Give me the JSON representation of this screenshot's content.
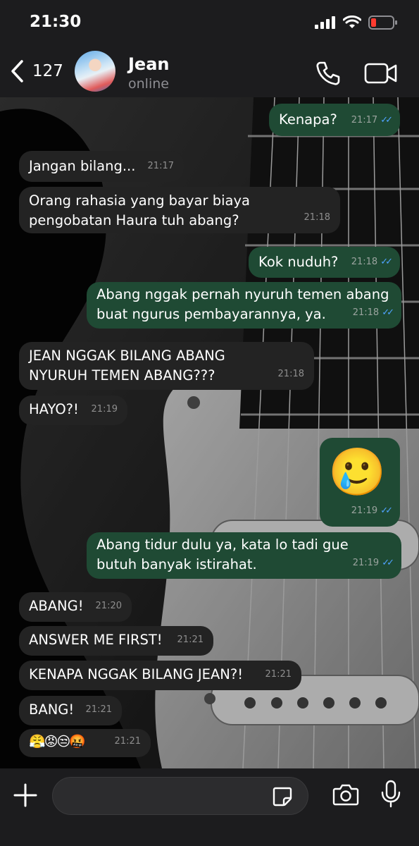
{
  "status_bar": {
    "time": "21:30"
  },
  "header": {
    "back_count": "127",
    "contact_name": "Jean",
    "contact_status": "online"
  },
  "messages": [
    {
      "direction": "out",
      "text": "Kenapa?",
      "time": "21:17",
      "read": true
    },
    {
      "direction": "in",
      "text": "Jangan bilang...",
      "time": "21:17"
    },
    {
      "direction": "in",
      "text": "Orang rahasia yang bayar biaya pengobatan Haura tuh abang?",
      "time": "21:18"
    },
    {
      "direction": "out",
      "text": "Kok nuduh?",
      "time": "21:18",
      "read": true
    },
    {
      "direction": "out",
      "text": "Abang nggak pernah nyuruh temen abang buat ngurus pembayarannya, ya.",
      "time": "21:18",
      "read": true
    },
    {
      "direction": "in",
      "text": "JEAN NGGAK BILANG ABANG NYURUH TEMEN ABANG???",
      "time": "21:18"
    },
    {
      "direction": "in",
      "text": "HAYO?!",
      "time": "21:19"
    },
    {
      "direction": "out",
      "text": "🥲",
      "time": "21:19",
      "read": true
    },
    {
      "direction": "out",
      "text": "Abang tidur dulu ya, kata lo tadi gue butuh banyak istirahat.",
      "time": "21:19",
      "read": true
    },
    {
      "direction": "in",
      "text": "ABANG!",
      "time": "21:20"
    },
    {
      "direction": "in",
      "text": "ANSWER ME FIRST!",
      "time": "21:21"
    },
    {
      "direction": "in",
      "text": "KENAPA NGGAK BILANG JEAN?!",
      "time": "21:21"
    },
    {
      "direction": "in",
      "text": "BANG!",
      "time": "21:21"
    },
    {
      "direction": "in",
      "text": "😤😡😒🤬",
      "time": "21:21"
    }
  ],
  "input": {
    "placeholder": ""
  },
  "colors": {
    "incoming_bubble": "#232323",
    "outgoing_bubble": "#1f4a34",
    "read_ticks": "#4fa3ff",
    "bar_background": "#1c1c1e"
  },
  "icons": [
    "back-chevron-icon",
    "phone-icon",
    "video-camera-icon",
    "plus-icon",
    "sticker-icon",
    "camera-icon",
    "microphone-icon",
    "signal-icon",
    "wifi-icon",
    "battery-icon"
  ]
}
